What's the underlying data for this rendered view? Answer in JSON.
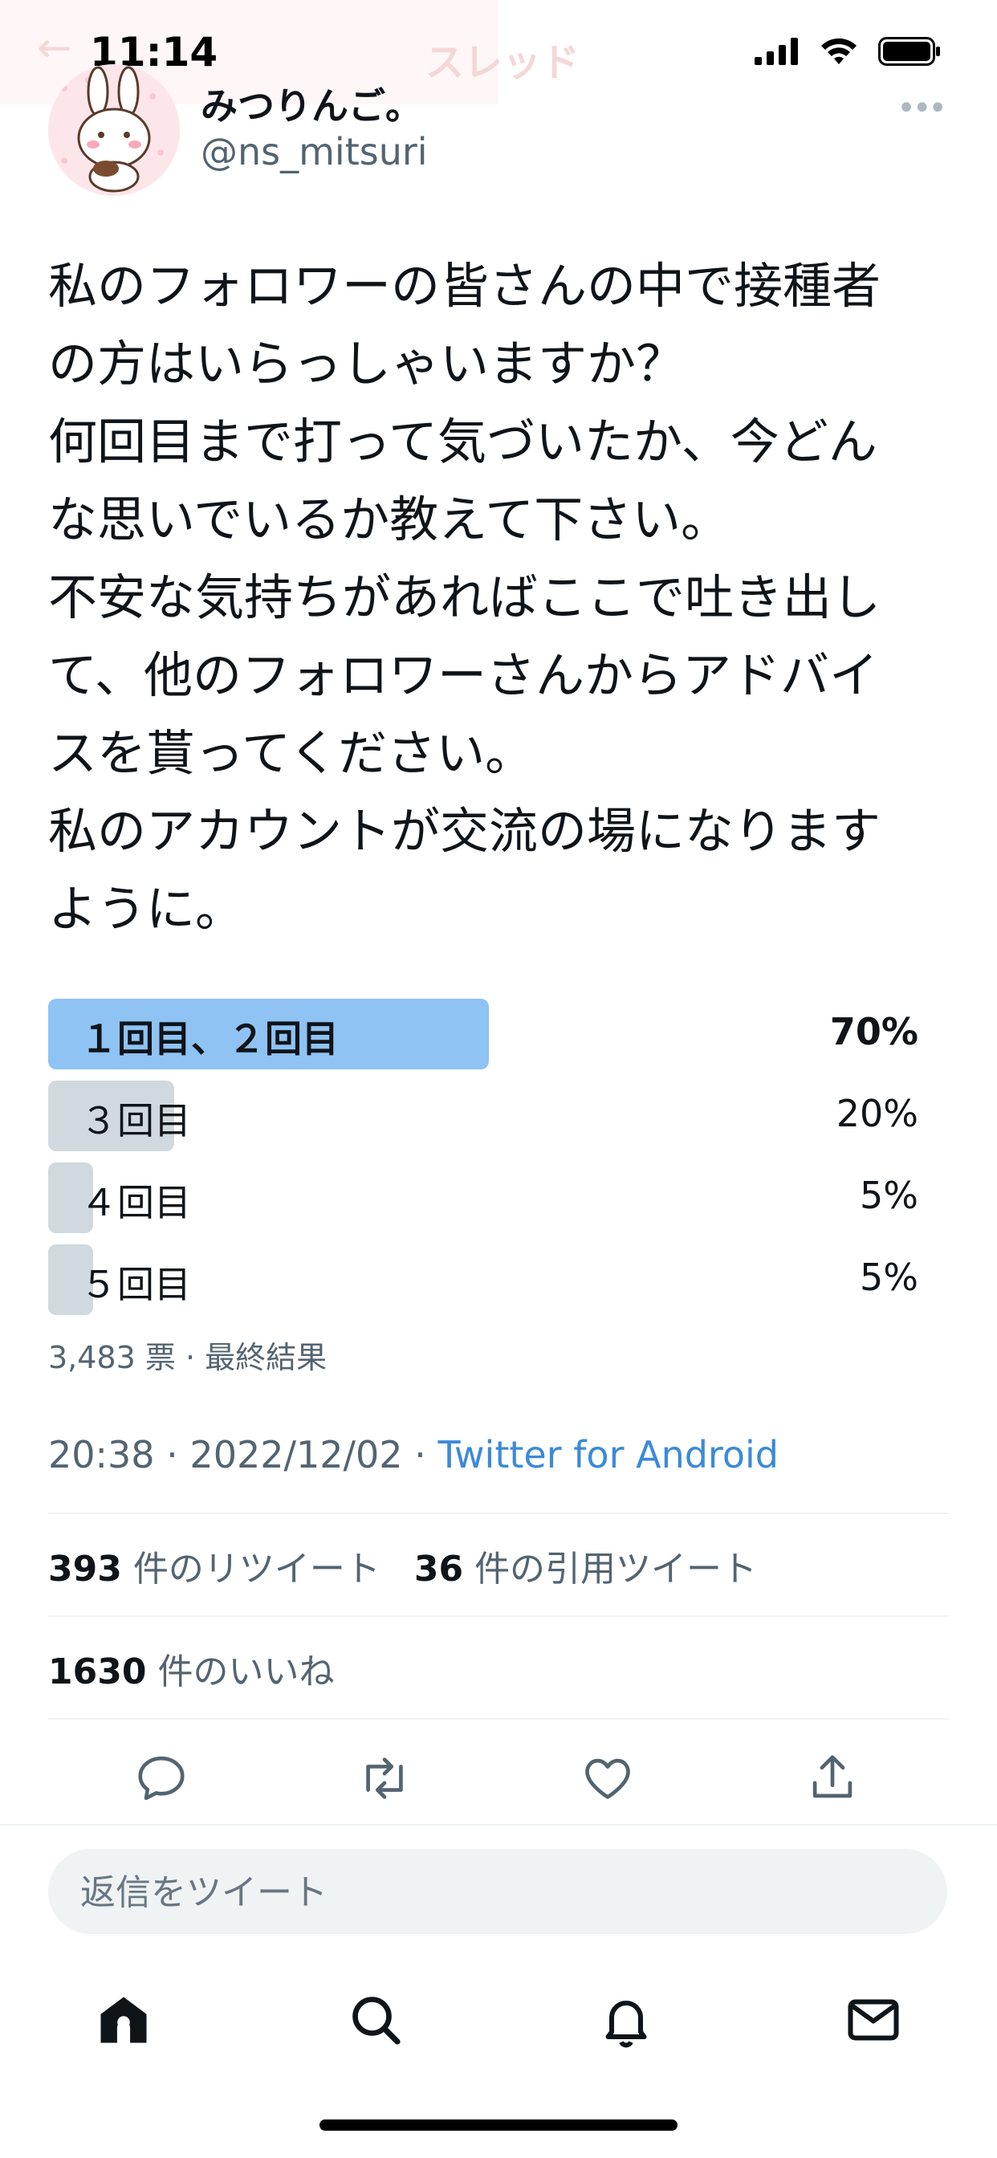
{
  "status_bar": {
    "time": "11:14"
  },
  "header": {
    "title_faded": "スレッド"
  },
  "author": {
    "display_name": "みつりんご。",
    "handle": "@ns_mitsuri"
  },
  "tweet": {
    "text": "私のフォロワーの皆さんの中で接種者\nの方はいらっしゃいますか？\n何回目まで打って気づいたか、今どん\nな思いでいるか教えて下さい。\n不安な気持ちがあればここで吐き出し\nて、他のフォロワーさんからアドバイ\nスを貰ってください。\n私のアカウントが交流の場になります\nように。"
  },
  "poll": {
    "options": [
      {
        "label": "１回目、２回目",
        "percent_text": "70%",
        "share": 0.7,
        "winner": true
      },
      {
        "label": "３回目",
        "percent_text": "20%",
        "share": 0.2,
        "winner": false
      },
      {
        "label": "４回目",
        "percent_text": "5%",
        "share": 0.05,
        "winner": false
      },
      {
        "label": "５回目",
        "percent_text": "5%",
        "share": 0.05,
        "winner": false
      }
    ],
    "meta": "3,483 票 · 最終結果"
  },
  "timestamp": {
    "time_date": "20:38 · 2022/12/02 · ",
    "source": "Twitter for Android"
  },
  "stats": {
    "retweets_count": "393",
    "retweets_label": "件のリツイート",
    "quotes_count": "36",
    "quotes_label": "件の引用ツイート",
    "likes_count": "1630",
    "likes_label": "件のいいね"
  },
  "reply": {
    "placeholder": "返信をツイート"
  },
  "colors": {
    "poll_winner": "#8ec3f3",
    "poll_other": "#cfd9de",
    "link": "#3b8ad9",
    "secondary_text": "#536471"
  }
}
